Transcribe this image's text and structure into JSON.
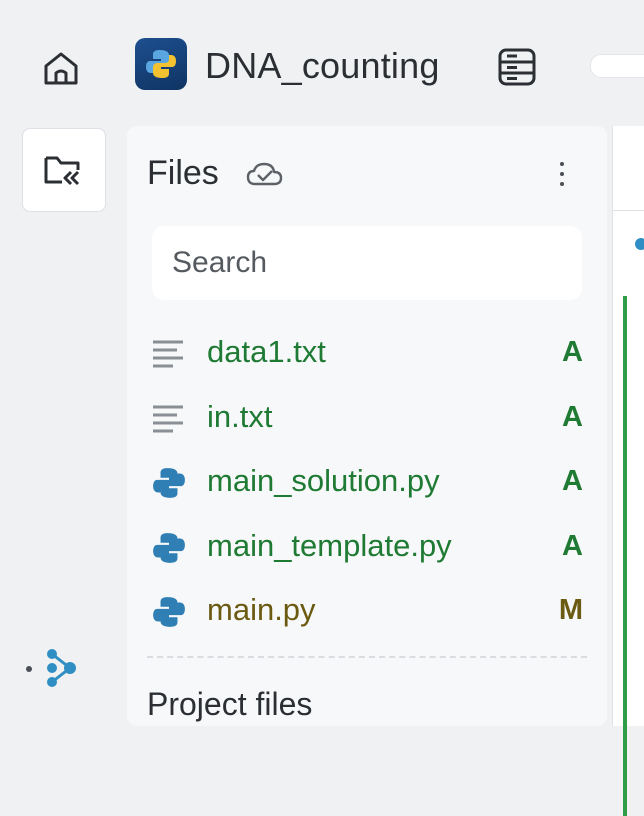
{
  "topbar": {
    "home_icon": "home-icon",
    "app_icon": "python-icon",
    "project_title": "DNA_counting",
    "server_icon": "server-icon"
  },
  "rail": {
    "toggle_icon": "folder-collapse-icon",
    "brand_icon": "brand-icon"
  },
  "files": {
    "title": "Files",
    "sync_icon": "cloud-check-icon",
    "menu_icon": "kebab-icon",
    "search_placeholder": "Search",
    "items": [
      {
        "name": "data1.txt",
        "icon": "text-file-icon",
        "status": "A"
      },
      {
        "name": "in.txt",
        "icon": "text-file-icon",
        "status": "A"
      },
      {
        "name": "main_solution.py",
        "icon": "python-icon",
        "status": "A"
      },
      {
        "name": "main_template.py",
        "icon": "python-icon",
        "status": "A"
      },
      {
        "name": "main.py",
        "icon": "python-icon",
        "status": "M"
      }
    ],
    "next_section": "Project files"
  },
  "colors": {
    "added": "#1f7a34",
    "modified": "#6b5a12",
    "python_blue": "#2f7fb5"
  }
}
